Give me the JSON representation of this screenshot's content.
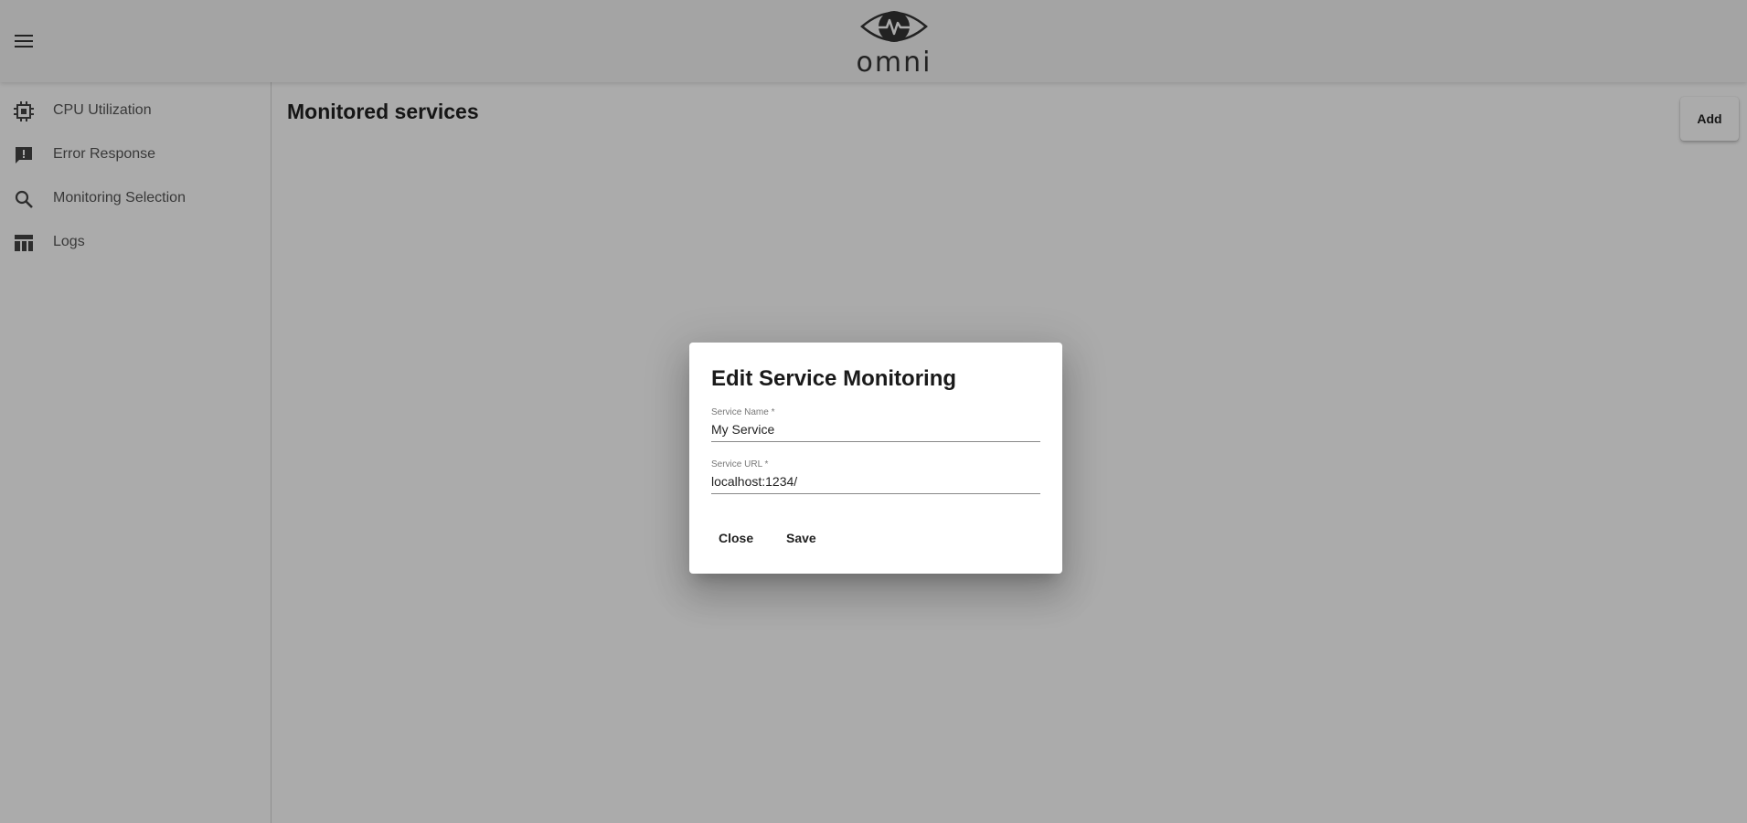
{
  "header": {
    "menu_icon": "menu-icon",
    "logo_icon": "eye-pulse-icon",
    "logo_text": "omni"
  },
  "sidebar": {
    "items": [
      {
        "label": "CPU Utilization",
        "icon": "cpu-chip-icon"
      },
      {
        "label": "Error Response",
        "icon": "feedback-icon"
      },
      {
        "label": "Monitoring Selection",
        "icon": "search-icon"
      },
      {
        "label": "Logs",
        "icon": "table-icon"
      }
    ]
  },
  "main": {
    "title": "Monitored services",
    "add_label": "Add"
  },
  "dialog": {
    "title": "Edit Service Monitoring",
    "service_name": {
      "label": "Service Name *",
      "value": "My Service"
    },
    "service_url": {
      "label": "Service URL *",
      "value": "localhost:1234/"
    },
    "close_label": "Close",
    "save_label": "Save"
  },
  "colors": {
    "backdrop": "#000000",
    "surface": "#ffffff",
    "text": "#222222"
  }
}
